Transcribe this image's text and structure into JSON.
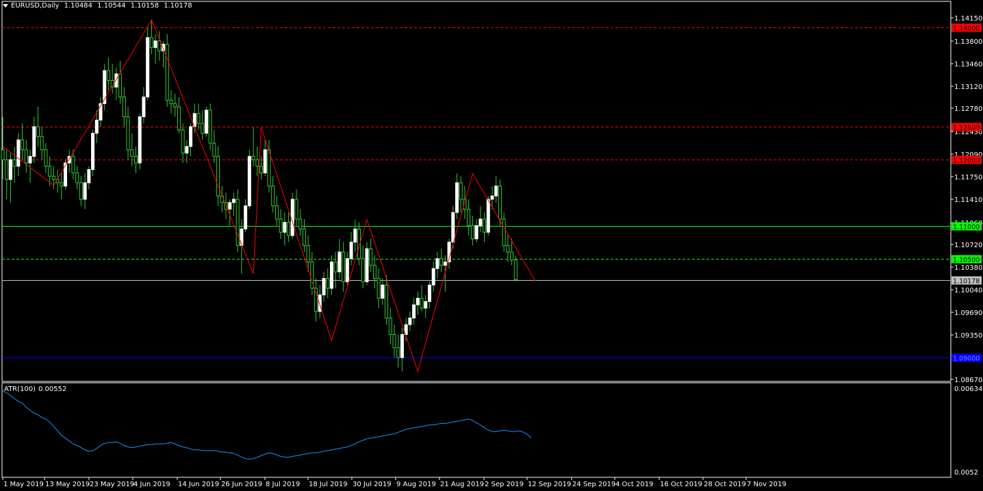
{
  "header": {
    "symbol": "EURUSD,Daily",
    "open": "1.10484",
    "high": "1.10544",
    "low": "1.10158",
    "close": "1.10178"
  },
  "indicator": {
    "name": "ATR(100)",
    "value": "0.00552"
  },
  "colors": {
    "background": "#000000",
    "bull": "#ffffff",
    "wick": "#32cd32",
    "zigzag": "#ff0000",
    "resistance": "#ff0000",
    "support_green": "#00ff00",
    "support_blue": "#0000ff",
    "bid": "#c0c0c0",
    "atr": "#1e90ff"
  },
  "chart_data": [
    {
      "type": "candlestick",
      "title": "EURUSD,Daily",
      "y_ticks": [
        "1.14150",
        "1.13800",
        "1.13460",
        "1.13120",
        "1.12780",
        "1.12430",
        "1.12090",
        "1.11750",
        "1.11410",
        "1.11060",
        "1.10720",
        "1.10380",
        "1.10040",
        "1.09690",
        "1.09350",
        "1.08670"
      ],
      "ylim": [
        1.086,
        1.144
      ],
      "x_ticks": [
        "1 May 2019",
        "13 May 2019",
        "23 May 2019",
        "4 Jun 2019",
        "14 Jun 2019",
        "26 Jun 2019",
        "8 Jul 2019",
        "18 Jul 2019",
        "30 Jul 2019",
        "9 Aug 2019",
        "21 Aug 2019",
        "2 Sep 2019",
        "12 Sep 2019",
        "24 Sep 2019",
        "4 Oct 2019",
        "16 Oct 2019",
        "28 Oct 2019",
        "7 Nov 2019"
      ],
      "levels": [
        {
          "price": 1.14,
          "label": "1.14000",
          "color": "#ff0000",
          "style": "dashed"
        },
        {
          "price": 1.125,
          "label": "1.12500",
          "color": "#ff0000",
          "style": "dashed"
        },
        {
          "price": 1.12,
          "label": "1.12000",
          "color": "#ff0000",
          "style": "dashed"
        },
        {
          "price": 1.11,
          "label": "1.11000",
          "color": "#00ff00",
          "style": "solid"
        },
        {
          "price": 1.105,
          "label": "1.10500",
          "color": "#00ff00",
          "style": "dashed"
        },
        {
          "price": 1.10178,
          "label": "1.10178",
          "color": "#c0c0c0",
          "style": "solid"
        },
        {
          "price": 1.09,
          "label": "1.09000",
          "color": "#0000ff",
          "style": "solid"
        }
      ],
      "zigzag": [
        {
          "date": "1 May 2019",
          "price": 1.122
        },
        {
          "date": "20 May 2019",
          "price": 1.1161
        },
        {
          "date": "25 Jun 2019",
          "price": 1.1412
        },
        {
          "date": "1 Aug 2019",
          "price": 1.1027
        },
        {
          "date": "5 Aug 2019",
          "price": 1.1249
        },
        {
          "date": "3 Sep 2019",
          "price": 1.0926
        },
        {
          "date": "13 Sep 2019",
          "price": 1.1109
        },
        {
          "date": "1 Oct 2019",
          "price": 1.0879
        },
        {
          "date": "21 Oct 2019",
          "price": 1.1179
        },
        {
          "date": "8 Nov 2019",
          "price": 1.1016
        }
      ],
      "ohlc": [
        [
          1.1215,
          1.1265,
          1.117,
          1.12
        ],
        [
          1.12,
          1.1215,
          1.114,
          1.117
        ],
        [
          1.117,
          1.121,
          1.1135,
          1.12
        ],
        [
          1.12,
          1.122,
          1.1165,
          1.119
        ],
        [
          1.119,
          1.124,
          1.1175,
          1.123
        ],
        [
          1.123,
          1.1255,
          1.12,
          1.1215
        ],
        [
          1.1215,
          1.123,
          1.118,
          1.1195
        ],
        [
          1.1195,
          1.1215,
          1.1165,
          1.1205
        ],
        [
          1.1205,
          1.1265,
          1.1195,
          1.125
        ],
        [
          1.125,
          1.128,
          1.122,
          1.1235
        ],
        [
          1.1235,
          1.125,
          1.12,
          1.1215
        ],
        [
          1.1215,
          1.1225,
          1.118,
          1.119
        ],
        [
          1.119,
          1.1205,
          1.116,
          1.1175
        ],
        [
          1.1175,
          1.119,
          1.1155,
          1.117
        ],
        [
          1.117,
          1.1185,
          1.115,
          1.1165
        ],
        [
          1.1165,
          1.118,
          1.114,
          1.116
        ],
        [
          1.116,
          1.12,
          1.1155,
          1.1195
        ],
        [
          1.1195,
          1.1215,
          1.118,
          1.1205
        ],
        [
          1.1205,
          1.1215,
          1.117,
          1.118
        ],
        [
          1.118,
          1.119,
          1.1155,
          1.1165
        ],
        [
          1.1165,
          1.1175,
          1.113,
          1.114
        ],
        [
          1.114,
          1.118,
          1.1125,
          1.1165
        ],
        [
          1.1165,
          1.119,
          1.1155,
          1.1185
        ],
        [
          1.1185,
          1.1245,
          1.1175,
          1.124
        ],
        [
          1.124,
          1.1275,
          1.1225,
          1.126
        ],
        [
          1.126,
          1.1295,
          1.125,
          1.1285
        ],
        [
          1.1285,
          1.1345,
          1.1275,
          1.1335
        ],
        [
          1.1335,
          1.1355,
          1.1305,
          1.132
        ],
        [
          1.132,
          1.1345,
          1.13,
          1.131
        ],
        [
          1.131,
          1.134,
          1.129,
          1.133
        ],
        [
          1.133,
          1.135,
          1.1285,
          1.1295
        ],
        [
          1.1295,
          1.131,
          1.125,
          1.1265
        ],
        [
          1.1265,
          1.128,
          1.12,
          1.1215
        ],
        [
          1.1215,
          1.124,
          1.119,
          1.1205
        ],
        [
          1.1205,
          1.122,
          1.118,
          1.1195
        ],
        [
          1.1195,
          1.127,
          1.1185,
          1.1265
        ],
        [
          1.1265,
          1.131,
          1.1255,
          1.1295
        ],
        [
          1.1295,
          1.14,
          1.129,
          1.1385
        ],
        [
          1.1385,
          1.1412,
          1.136,
          1.137
        ],
        [
          1.137,
          1.139,
          1.1345,
          1.138
        ],
        [
          1.138,
          1.1395,
          1.135,
          1.1365
        ],
        [
          1.1365,
          1.138,
          1.134,
          1.1375
        ],
        [
          1.1375,
          1.139,
          1.128,
          1.129
        ],
        [
          1.129,
          1.1305,
          1.127,
          1.1285
        ],
        [
          1.1285,
          1.13,
          1.1265,
          1.128
        ],
        [
          1.128,
          1.1295,
          1.124,
          1.1245
        ],
        [
          1.1245,
          1.1255,
          1.1195,
          1.121
        ],
        [
          1.121,
          1.123,
          1.1195,
          1.122
        ],
        [
          1.122,
          1.1255,
          1.1205,
          1.125
        ],
        [
          1.125,
          1.1285,
          1.124,
          1.127
        ],
        [
          1.127,
          1.1285,
          1.1245,
          1.1255
        ],
        [
          1.1255,
          1.1275,
          1.123,
          1.124
        ],
        [
          1.124,
          1.128,
          1.1235,
          1.1275
        ],
        [
          1.1275,
          1.1285,
          1.1215,
          1.1225
        ],
        [
          1.1225,
          1.1245,
          1.1195,
          1.1205
        ],
        [
          1.1205,
          1.122,
          1.113,
          1.1145
        ],
        [
          1.1145,
          1.116,
          1.112,
          1.1135
        ],
        [
          1.1135,
          1.115,
          1.111,
          1.1125
        ],
        [
          1.1125,
          1.114,
          1.11,
          1.1135
        ],
        [
          1.1135,
          1.115,
          1.1115,
          1.114
        ],
        [
          1.114,
          1.1155,
          1.106,
          1.107
        ],
        [
          1.107,
          1.111,
          1.1027,
          1.1095
        ],
        [
          1.1095,
          1.114,
          1.109,
          1.113
        ],
        [
          1.113,
          1.1215,
          1.1125,
          1.1205
        ],
        [
          1.1205,
          1.1249,
          1.119,
          1.12
        ],
        [
          1.12,
          1.122,
          1.1175,
          1.119
        ],
        [
          1.119,
          1.1205,
          1.117,
          1.118
        ],
        [
          1.118,
          1.123,
          1.1175,
          1.1215
        ],
        [
          1.1215,
          1.123,
          1.115,
          1.116
        ],
        [
          1.116,
          1.1175,
          1.112,
          1.113
        ],
        [
          1.113,
          1.1145,
          1.11,
          1.111
        ],
        [
          1.111,
          1.1125,
          1.108,
          1.109
        ],
        [
          1.109,
          1.112,
          1.107,
          1.1105
        ],
        [
          1.1105,
          1.112,
          1.1075,
          1.1085
        ],
        [
          1.1085,
          1.115,
          1.108,
          1.114
        ],
        [
          1.114,
          1.1155,
          1.11,
          1.111
        ],
        [
          1.111,
          1.1125,
          1.1085,
          1.1095
        ],
        [
          1.1095,
          1.111,
          1.106,
          1.107
        ],
        [
          1.107,
          1.1085,
          1.103,
          1.1045
        ],
        [
          1.1045,
          1.106,
          1.0995,
          1.1005
        ],
        [
          1.1005,
          1.102,
          1.0955,
          1.097
        ],
        [
          1.097,
          1.101,
          1.096,
          1.0995
        ],
        [
          1.0995,
          1.103,
          1.0985,
          1.102
        ],
        [
          1.102,
          1.1035,
          1.099,
          1.1005
        ],
        [
          1.1005,
          1.1055,
          1.0995,
          1.1045
        ],
        [
          1.1045,
          1.106,
          1.1005,
          1.103
        ],
        [
          1.103,
          1.108,
          1.102,
          1.106
        ],
        [
          1.106,
          1.1075,
          1.1,
          1.1015
        ],
        [
          1.1015,
          1.106,
          1.101,
          1.105
        ],
        [
          1.105,
          1.109,
          1.104,
          1.1075
        ],
        [
          1.1075,
          1.1109,
          1.106,
          1.1095
        ],
        [
          1.1095,
          1.1105,
          1.104,
          1.105
        ],
        [
          1.105,
          1.107,
          1.1005,
          1.1015
        ],
        [
          1.1015,
          1.1075,
          1.101,
          1.1065
        ],
        [
          1.1065,
          1.108,
          1.103,
          1.104
        ],
        [
          1.104,
          1.1055,
          1.1005,
          1.102
        ],
        [
          1.102,
          1.1035,
          1.0975,
          1.099
        ],
        [
          1.099,
          1.102,
          1.098,
          1.101
        ],
        [
          1.101,
          1.1025,
          1.095,
          1.096
        ],
        [
          1.096,
          1.0975,
          1.092,
          1.0935
        ],
        [
          1.0935,
          1.095,
          1.09,
          1.0915
        ],
        [
          1.0915,
          1.0935,
          1.0885,
          1.09
        ],
        [
          1.09,
          1.0945,
          1.0879,
          1.0935
        ],
        [
          1.0935,
          1.096,
          1.0925,
          1.095
        ],
        [
          1.095,
          1.097,
          1.094,
          1.096
        ],
        [
          1.096,
          1.099,
          1.095,
          1.098
        ],
        [
          1.098,
          1.1,
          1.0965,
          1.099
        ],
        [
          1.099,
          1.101,
          1.097,
          1.0975
        ],
        [
          1.0975,
          1.0995,
          1.096,
          1.0985
        ],
        [
          1.0985,
          1.1015,
          1.0975,
          1.101
        ],
        [
          1.101,
          1.1045,
          1.1,
          1.1035
        ],
        [
          1.1035,
          1.106,
          1.102,
          1.105
        ],
        [
          1.105,
          1.1065,
          1.103,
          1.104
        ],
        [
          1.104,
          1.1055,
          1.1,
          1.1045
        ],
        [
          1.1045,
          1.108,
          1.1035,
          1.1075
        ],
        [
          1.1075,
          1.113,
          1.1065,
          1.112
        ],
        [
          1.112,
          1.1179,
          1.111,
          1.1165
        ],
        [
          1.1165,
          1.1175,
          1.112,
          1.114
        ],
        [
          1.114,
          1.116,
          1.111,
          1.1125
        ],
        [
          1.1125,
          1.114,
          1.1085,
          1.11
        ],
        [
          1.11,
          1.1115,
          1.107,
          1.108
        ],
        [
          1.108,
          1.111,
          1.1075,
          1.11
        ],
        [
          1.11,
          1.113,
          1.109,
          1.111
        ],
        [
          1.111,
          1.112,
          1.1075,
          1.109
        ],
        [
          1.109,
          1.1145,
          1.1085,
          1.114
        ],
        [
          1.114,
          1.116,
          1.1125,
          1.1145
        ],
        [
          1.1145,
          1.1175,
          1.1135,
          1.116
        ],
        [
          1.116,
          1.117,
          1.11,
          1.111
        ],
        [
          1.111,
          1.112,
          1.106,
          1.107
        ],
        [
          1.107,
          1.1085,
          1.1045,
          1.106
        ],
        [
          1.106,
          1.108,
          1.104,
          1.1048
        ],
        [
          1.1048,
          1.1054,
          1.1016,
          1.1018
        ]
      ]
    },
    {
      "type": "line",
      "title": "ATR(100)",
      "y_ticks": [
        "0.00634",
        "0.0052"
      ],
      "ylim": [
        0.0052,
        0.00634
      ],
      "series": [
        {
          "name": "ATR(100)",
          "values": [
            0.0063,
            0.00628,
            0.00624,
            0.0062,
            0.00616,
            0.00614,
            0.00608,
            0.00604,
            0.006,
            0.00598,
            0.00594,
            0.00592,
            0.00588,
            0.00582,
            0.00576,
            0.0057,
            0.00566,
            0.00562,
            0.00558,
            0.00556,
            0.00553,
            0.0055,
            0.00548,
            0.00549,
            0.00552,
            0.00556,
            0.00559,
            0.0056,
            0.0056,
            0.00561,
            0.00559,
            0.00556,
            0.00554,
            0.00553,
            0.00554,
            0.00555,
            0.00556,
            0.00557,
            0.00557,
            0.00558,
            0.00558,
            0.00558,
            0.00559,
            0.0056,
            0.00558,
            0.00556,
            0.00554,
            0.00553,
            0.00551,
            0.0055,
            0.0055,
            0.00549,
            0.00549,
            0.00549,
            0.00549,
            0.00548,
            0.00547,
            0.00547,
            0.00546,
            0.00545,
            0.00543,
            0.0054,
            0.00538,
            0.00537,
            0.00538,
            0.0054,
            0.00542,
            0.00544,
            0.00546,
            0.00545,
            0.00543,
            0.00541,
            0.0054,
            0.0054,
            0.00541,
            0.00542,
            0.00543,
            0.00544,
            0.00545,
            0.00546,
            0.00546,
            0.00547,
            0.00548,
            0.00549,
            0.0055,
            0.00551,
            0.00552,
            0.00553,
            0.00554,
            0.00556,
            0.00558,
            0.00561,
            0.00563,
            0.00565,
            0.00566,
            0.00567,
            0.00568,
            0.00569,
            0.0057,
            0.00571,
            0.00572,
            0.00574,
            0.00576,
            0.00578,
            0.00579,
            0.0058,
            0.00581,
            0.00582,
            0.00583,
            0.00584,
            0.00584,
            0.00585,
            0.00586,
            0.00586,
            0.00587,
            0.00588,
            0.00589,
            0.0059,
            0.00591,
            0.00592,
            0.0059,
            0.00587,
            0.00584,
            0.0058,
            0.00577,
            0.00575,
            0.00575,
            0.00576,
            0.00577,
            0.00576,
            0.00575,
            0.00575,
            0.00576,
            0.00574,
            0.00571,
            0.00566
          ]
        }
      ]
    }
  ]
}
